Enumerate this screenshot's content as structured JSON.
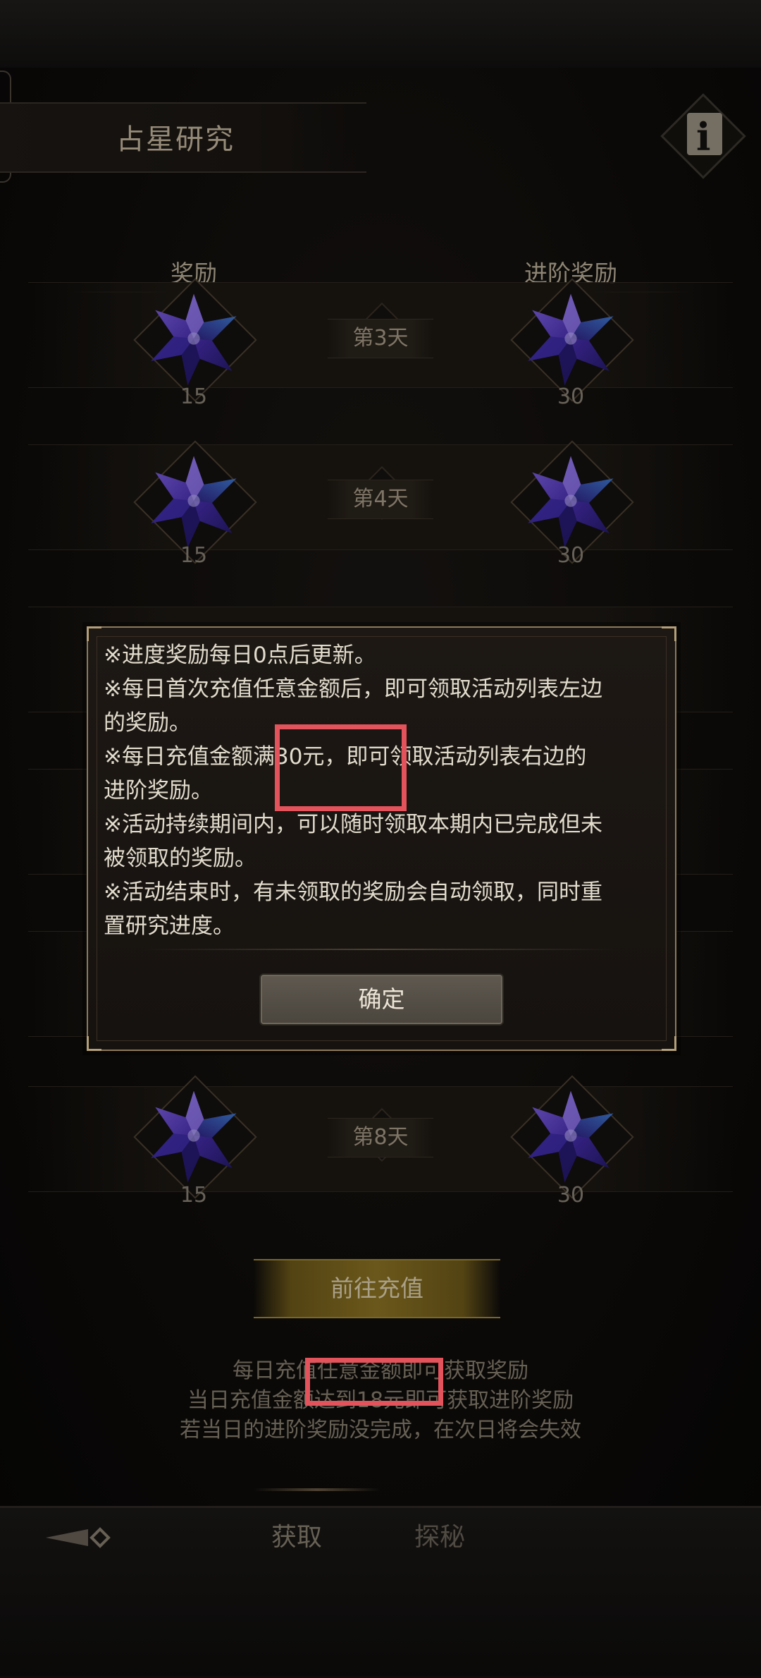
{
  "header": {
    "title": "占星研究"
  },
  "columns": {
    "left": "奖励",
    "right": "进阶奖励"
  },
  "rows": [
    {
      "day": "第3天",
      "left_count": "15",
      "right_count": "30"
    },
    {
      "day": "第4天",
      "left_count": "15",
      "right_count": "30"
    },
    {
      "day": "第8天",
      "left_count": "15",
      "right_count": "30"
    }
  ],
  "partial": {
    "right_count_a": "30",
    "right_count_b": "30"
  },
  "recharge": {
    "label": "前往充值"
  },
  "notes": [
    "每日充值任意金额即可获取奖励",
    "当日充值金额达到18元即可获取进阶奖励",
    "若当日的进阶奖励没完成，在次日将会失效"
  ],
  "nav": {
    "tab_acquire": "获取",
    "tab_explore": "探秘"
  },
  "modal": {
    "lines": [
      "※进度奖励每日0点后更新。",
      "※每日首次充值任意金额后，即可领取活动列表左边",
      "的奖励。",
      "※每日充值金额满30元，即可领取活动列表右边的",
      "进阶奖励。",
      "※活动持续期间内，可以随时领取本期内已完成但未",
      "被领取的奖励。",
      "※活动结束时，有未领取的奖励会自动领取，同时重",
      "置研究进度。"
    ],
    "confirm_label": "确定"
  },
  "colors": {
    "highlight": "#e3535b",
    "gold_button": "#8e7524",
    "star_primary": "#5a3ec8",
    "star_secondary": "#2f6fbf"
  },
  "icons": {
    "reward": "purple-star-crystal-icon",
    "info": "info-icon",
    "back": "back-arrow-icon"
  }
}
